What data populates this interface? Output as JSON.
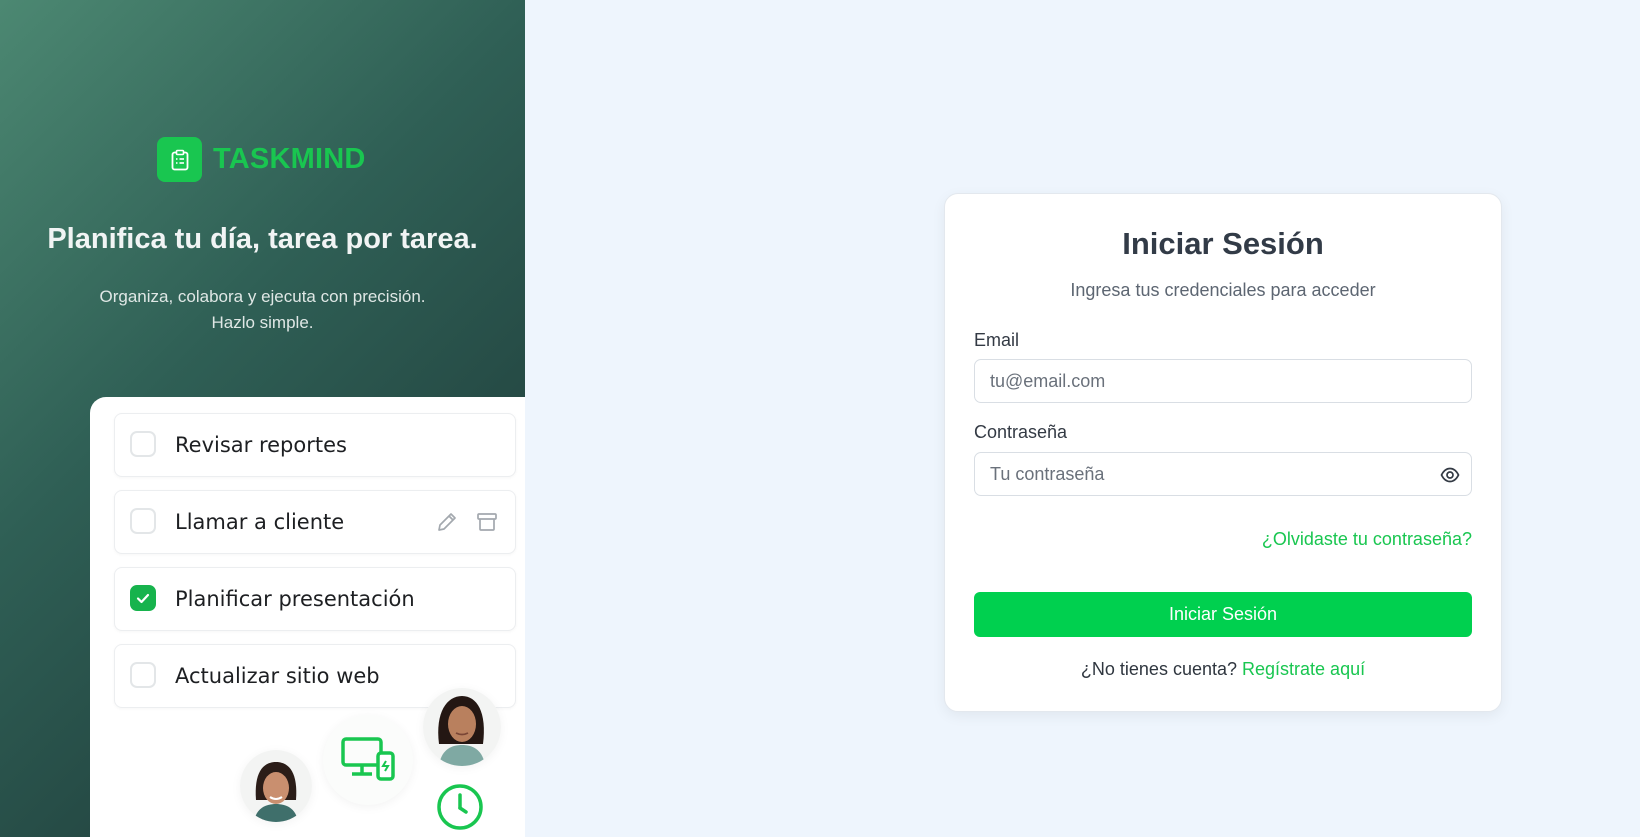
{
  "brand": {
    "name": "TASKMIND",
    "logo_icon": "clipboard-icon",
    "color": "#19c650"
  },
  "hero": {
    "tagline": "Planifica tu día, tarea por tarea.",
    "subtitle_line1": "Organiza, colabora y ejecuta con precisión.",
    "subtitle_line2": "Hazlo simple."
  },
  "tasks": [
    {
      "label": "Revisar reportes",
      "checked": false
    },
    {
      "label": "Llamar a cliente",
      "checked": false
    },
    {
      "label": "Planificar presentación",
      "checked": true
    },
    {
      "label": "Actualizar sitio web",
      "checked": false
    }
  ],
  "login": {
    "title": "Iniciar Sesión",
    "subtitle": "Ingresa tus credenciales para acceder",
    "email_label": "Email",
    "email_placeholder": "tu@email.com",
    "email_value": "",
    "password_label": "Contraseña",
    "password_placeholder": "Tu contraseña",
    "password_value": "",
    "forgot_link": "¿Olvidaste tu contraseña?",
    "submit_label": "Iniciar Sesión",
    "no_account_text": "¿No tienes cuenta?",
    "register_link": "Regístrate aquí"
  },
  "colors": {
    "accent": "#00d04f",
    "page_background": "#eef5fd",
    "panel_gradient_start": "#4c8872",
    "panel_gradient_end": "#1a3232"
  }
}
